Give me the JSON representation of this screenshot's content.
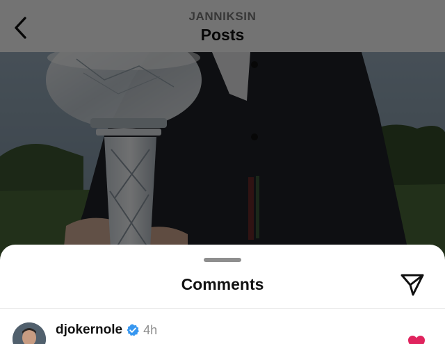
{
  "header": {
    "username": "JANNIKSIN",
    "title": "Posts"
  },
  "comments_sheet": {
    "title": "Comments",
    "comments": [
      {
        "username": "djokernole",
        "verified": true,
        "time": "4h",
        "text": "",
        "liked": true
      }
    ]
  },
  "colors": {
    "verified_badge": "#3797f0",
    "like_heart": "#e0245e"
  },
  "icons": {
    "back": "chevron-left-icon",
    "share": "paper-plane-icon",
    "verified": "verified-badge-icon",
    "like": "heart-icon"
  }
}
